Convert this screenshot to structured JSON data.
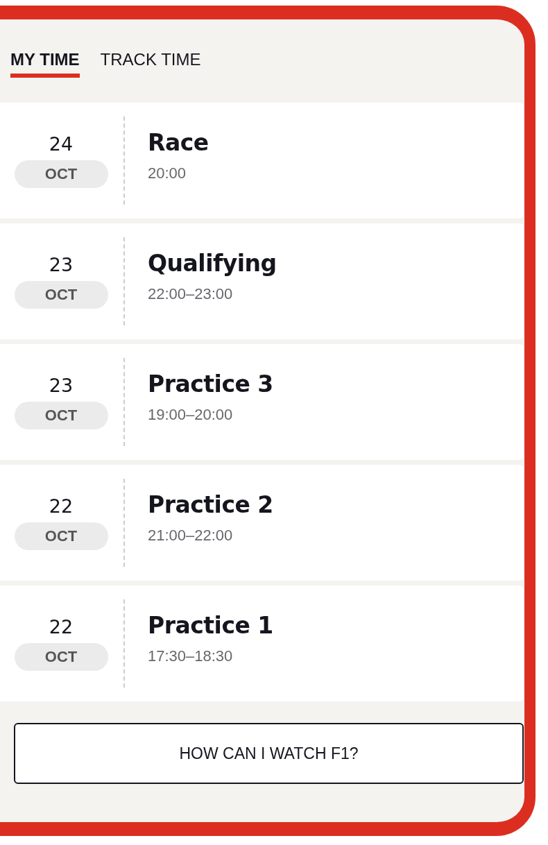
{
  "tabs": [
    {
      "label": "MY TIME",
      "selected": true
    },
    {
      "label": "TRACK TIME",
      "selected": false
    }
  ],
  "sessions": [
    {
      "day": "24",
      "month": "OCT",
      "name": "Race",
      "time": "20:00"
    },
    {
      "day": "23",
      "month": "OCT",
      "name": "Qualifying",
      "time": "22:00–23:00"
    },
    {
      "day": "23",
      "month": "OCT",
      "name": "Practice 3",
      "time": "19:00–20:00"
    },
    {
      "day": "22",
      "month": "OCT",
      "name": "Practice 2",
      "time": "21:00–22:00"
    },
    {
      "day": "22",
      "month": "OCT",
      "name": "Practice 1",
      "time": "17:30–18:30"
    }
  ],
  "watch_button": "HOW CAN I WATCH F1?"
}
